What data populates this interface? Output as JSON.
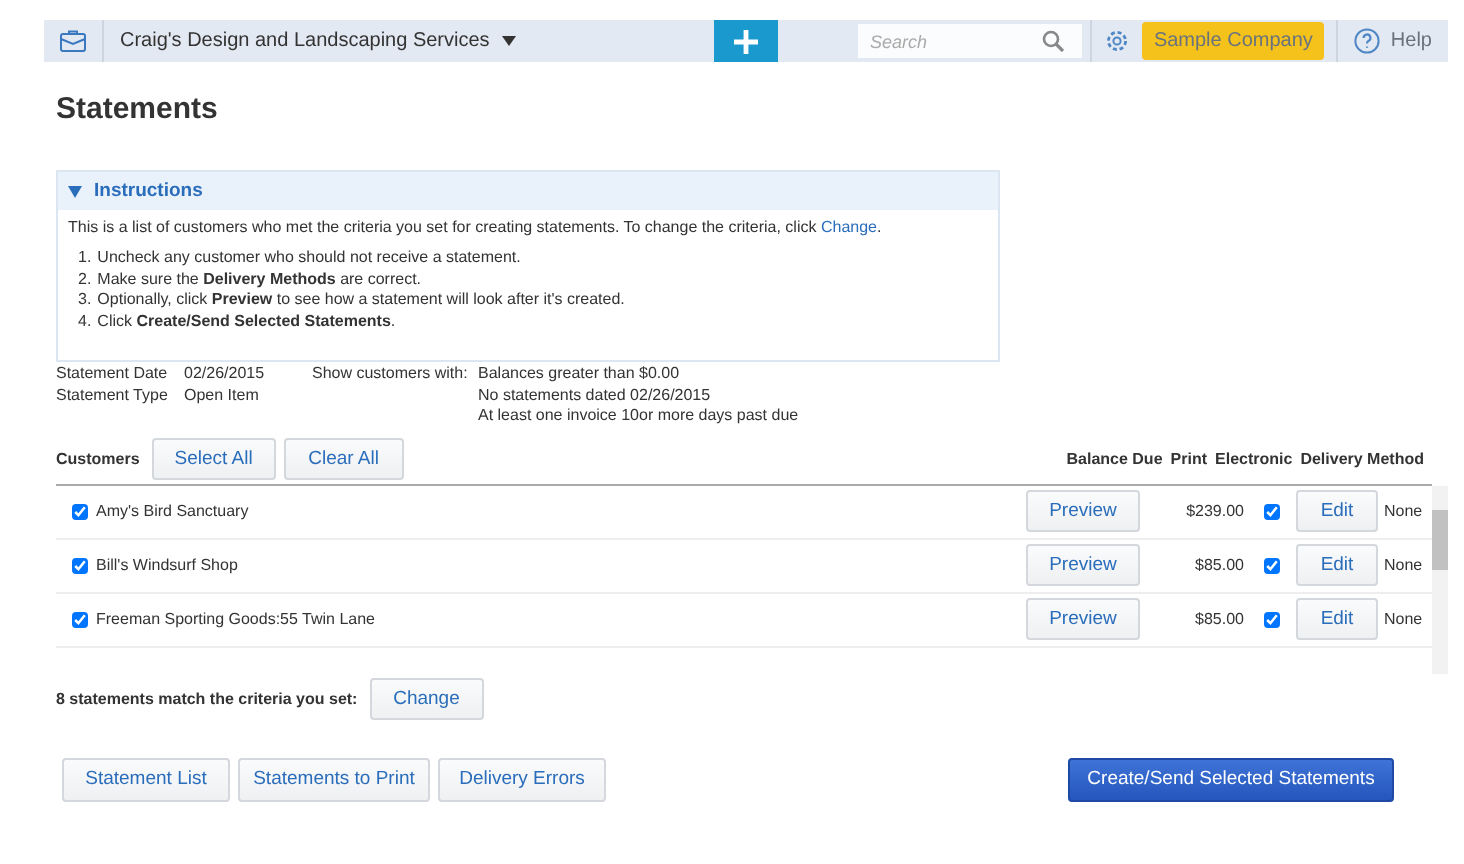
{
  "topbar": {
    "company": "Craig's Design and Landscaping Services",
    "search": {
      "placeholder": "Search"
    },
    "sample_button": "Sample Company",
    "help": "Help"
  },
  "title": "Statements",
  "instructions": {
    "title": "Instructions",
    "expanded": true,
    "intro": "This is a list of customers who met the criteria you set for creating statements. To change the criteria, click",
    "intro_link": "Change",
    "intro_end": ".",
    "steps": [
      {
        "number": "1.",
        "text": "Uncheck any customer who should not receive a statement."
      },
      {
        "number": "2.",
        "text": "Make sure the **Delivery Methods** are correct."
      },
      {
        "number": "3.",
        "text": "Optionally, click **Preview** to see how a statement will look after it's created."
      },
      {
        "number": "4.",
        "text": "Click **Create/Send Selected Statements**."
      }
    ]
  },
  "summary": {
    "date_label": "Statement Date",
    "date": "02/26/2015",
    "type_label": "Statement Type",
    "type": "Open Item",
    "show_label": "Show customers with:",
    "criteria": [
      "Balances greater than $0.00",
      "No statements dated 02/26/2015",
      "At least one invoice 10or more days past due"
    ]
  },
  "table": {
    "customers_label": "Customers",
    "select_all": "Select All",
    "clear_all": "Clear All",
    "columns": [
      "Balance Due",
      "Print",
      "Electronic",
      "Delivery Method"
    ],
    "rows": [
      {
        "checked": true,
        "name": "Amy's Bird Sanctuary",
        "preview": "Preview",
        "balance": "$239.00",
        "print": true,
        "edit": "Edit",
        "method": "None"
      },
      {
        "checked": true,
        "name": "Bill's Windsurf Shop",
        "preview": "Preview",
        "balance": "$85.00",
        "print": true,
        "edit": "Edit",
        "method": "None"
      },
      {
        "checked": true,
        "name": "Freeman Sporting Goods:55 Twin Lane",
        "preview": "Preview",
        "balance": "$85.00",
        "print": true,
        "edit": "Edit",
        "method": "None"
      }
    ]
  },
  "match": {
    "text": "8 statements match the criteria you set:",
    "button": "Change"
  },
  "footer": {
    "buttons": [
      "Statement List",
      "Statements to Print",
      "Delivery Errors"
    ],
    "primary": "Create/Send Selected Statements"
  }
}
